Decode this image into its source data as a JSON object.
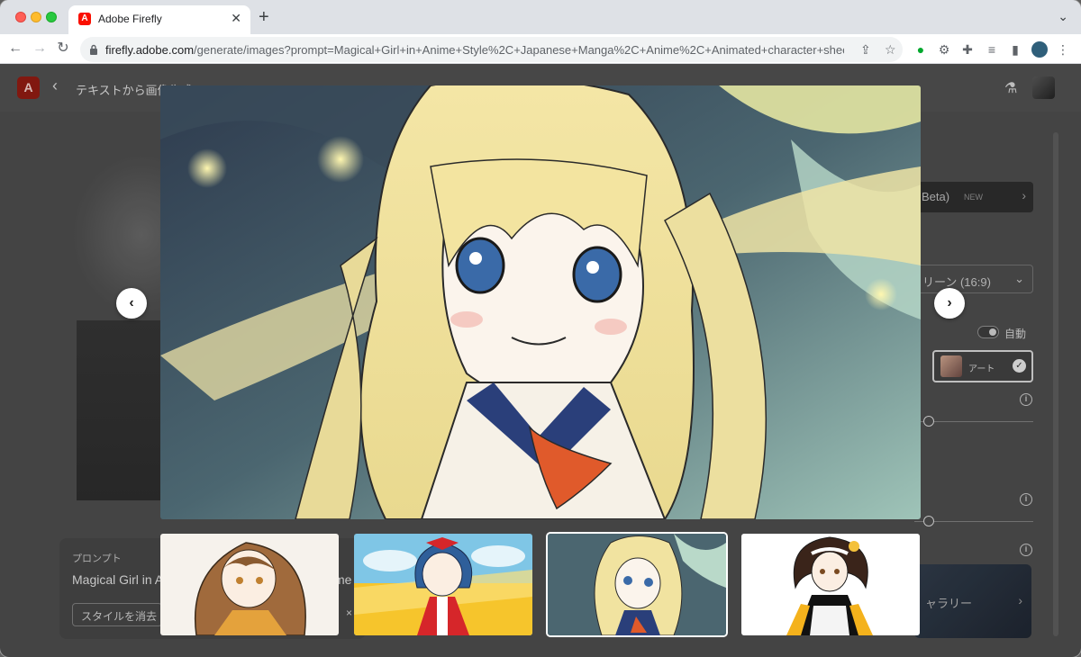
{
  "browser": {
    "tab_title": "Adobe Firefly",
    "tab_favicon": "adobe-logo",
    "new_tab_label": "+",
    "url_host": "firefly.adobe.com",
    "url_path": "/generate/images?prompt=Magical+Girl+in+Anime+Style%2C+Japanese+Manga%2C+Anime%2C+Animated+character+sheets&st...",
    "extensions": [
      "evernote-icon",
      "extension-gear-icon",
      "puzzle-icon",
      "media-icon",
      "sidebar-icon",
      "profile-avatar"
    ]
  },
  "app": {
    "logo_text": "A",
    "page_title": "テキストから画像生成",
    "beta_label": "Beta)",
    "new_badge": "NEW",
    "aspect_value": "リーン (16:9)",
    "auto_label": "自動",
    "art_label": "アート",
    "gallery_label": "ャラリー",
    "prompt_heading": "プロンプト",
    "prompt_text": "Magical Girl in A",
    "prompt_text_tail": "me",
    "clear_style_label": "スタイルを消去",
    "clear_x": "×"
  },
  "viewer": {
    "prev_icon": "‹",
    "next_icon": "›",
    "selected_index": 2,
    "thumbnails": [
      {
        "name": "thumbnail-brown-hair-girl"
      },
      {
        "name": "thumbnail-blue-hair-girl"
      },
      {
        "name": "thumbnail-blonde-girl"
      },
      {
        "name": "thumbnail-dark-hair-girl"
      }
    ]
  },
  "colors": {
    "adobe_red": "#fa0f00",
    "overlay_bg": "#4a4a4a"
  }
}
